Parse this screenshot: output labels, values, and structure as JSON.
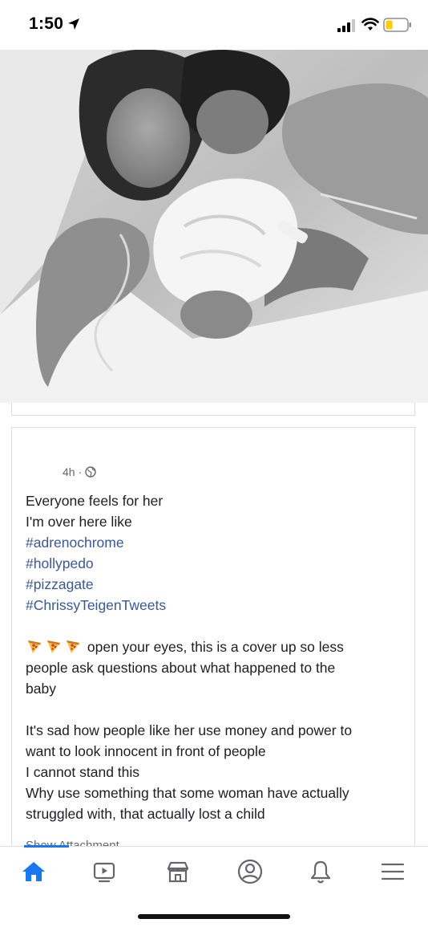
{
  "status_bar": {
    "time": "1:50",
    "icons": [
      "location-arrow-icon",
      "cell-signal-icon",
      "wifi-icon",
      "battery-icon"
    ]
  },
  "photo": {
    "description_icon": "photo"
  },
  "post": {
    "timestamp": "4h ·",
    "privacy_icon": "globe-icon",
    "lines": [
      "Everyone feels for her",
      "I'm over here like"
    ],
    "hashtags": [
      "#adrenochrome",
      "#hollypedo",
      "#pizzagate",
      "#ChrissyTeigenTweets"
    ],
    "paragraph_1": {
      "emoji_icons": [
        "pizza-icon",
        "pizza-icon",
        "pizza-icon"
      ],
      "first_line": "open your eyes, this is a cover up so less",
      "line_2": "people ask questions about what happened to the",
      "line_3": "baby"
    },
    "paragraph_2": [
      "It's sad how people like her use money and power to",
      "want to look innocent in front of people",
      "I cannot stand this",
      "Why use something that some woman have actually",
      "struggled with, that actually lost a child"
    ],
    "show_attachment": "Show Attachment"
  },
  "bottom_nav": {
    "items": [
      "home-icon",
      "watch-icon",
      "marketplace-icon",
      "profile-icon",
      "notifications-icon",
      "menu-icon"
    ],
    "active": "home-icon",
    "accent": "#1877f2"
  }
}
